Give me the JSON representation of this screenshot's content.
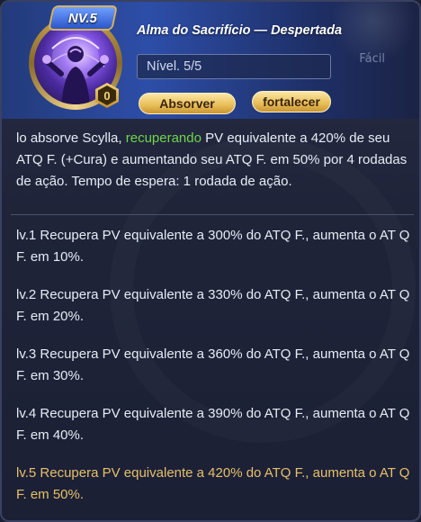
{
  "header": {
    "level_badge": "NV.5",
    "title": "Alma do Sacrifício — Despertada",
    "level_text": "Nível. 5/5",
    "star_count": "0",
    "absorb_label": "Absorver",
    "strengthen_label": "fortalecer",
    "ghost_label": "Fácil"
  },
  "description": {
    "part1": "lo absorve Scylla, ",
    "highlight": "recuperando",
    "part2": " PV equivalente a 420% de seu ATQ F. (+Cura) e aumentando seu ATQ F. em 50% por 4 rodadas de ação. Tempo de espera: 1 rodada de ação.",
    "highlight_color": "#6fd64b"
  },
  "levels": [
    {
      "text": "lv.1 Recupera PV equivalente a 300% do ATQ F., aumenta o AT Q F. em 10%."
    },
    {
      "text": "lv.2 Recupera PV equivalente a 330% do ATQ F., aumenta o AT Q F. em 20%."
    },
    {
      "text": "lv.3 Recupera PV equivalente a 360% do ATQ F., aumenta o AT Q F. em 30%."
    },
    {
      "text": "lv.4 Recupera PV equivalente a 390% do ATQ F., aumenta o AT Q F. em 40%."
    },
    {
      "text": "lv.5 Recupera PV equivalente a 420% do ATQ F., aumenta o AT Q F. em 50%."
    }
  ],
  "colors": {
    "active_level": "#e7c069",
    "gold_button": "#e8bd57"
  }
}
